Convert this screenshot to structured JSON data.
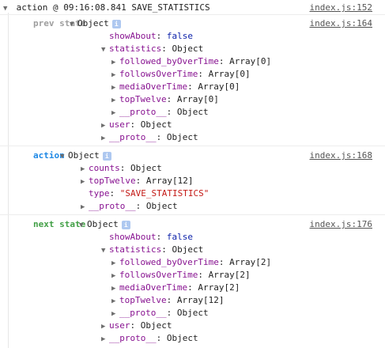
{
  "header": {
    "title": "action @ 09:16:08.841 SAVE_STATISTICS",
    "link": "index.js:152"
  },
  "groups": [
    {
      "label": "prev state",
      "label_color": "#9e9e9e",
      "link": "index.js:164",
      "lines": [
        {
          "indent": 0,
          "tri": "▼",
          "key": "",
          "val": "Object",
          "info": true
        },
        {
          "indent": 1,
          "key": "showAbout",
          "val": "false",
          "vclass": "kw"
        },
        {
          "indent": 1,
          "tri": "▼",
          "key": "statistics",
          "val": "Object"
        },
        {
          "indent": 2,
          "tri": "▶",
          "key": "followed_byOverTime",
          "val": "Array[0]"
        },
        {
          "indent": 2,
          "tri": "▶",
          "key": "followsOverTime",
          "val": "Array[0]"
        },
        {
          "indent": 2,
          "tri": "▶",
          "key": "mediaOverTime",
          "val": "Array[0]"
        },
        {
          "indent": 2,
          "tri": "▶",
          "key": "topTwelve",
          "val": "Array[0]"
        },
        {
          "indent": 2,
          "tri": "▶",
          "key": "__proto__",
          "val": "Object"
        },
        {
          "indent": 1,
          "tri": "▶",
          "key": "user",
          "val": "Object"
        },
        {
          "indent": 1,
          "tri": "▶",
          "key": "__proto__",
          "val": "Object"
        }
      ]
    },
    {
      "label": "action",
      "label_color": "#1e88e5",
      "link": "index.js:168",
      "lines": [
        {
          "indent": 0,
          "tri": "▼",
          "key": "",
          "val": "Object",
          "info": true
        },
        {
          "indent": 1,
          "tri": "▶",
          "key": "counts",
          "val": "Object"
        },
        {
          "indent": 1,
          "tri": "▶",
          "key": "topTwelve",
          "val": "Array[12]"
        },
        {
          "indent": 1,
          "key": "type",
          "val": "\"SAVE_STATISTICS\"",
          "vclass": "str"
        },
        {
          "indent": 1,
          "tri": "▶",
          "key": "__proto__",
          "val": "Object"
        }
      ]
    },
    {
      "label": "next state",
      "label_color": "#43a047",
      "link": "index.js:176",
      "lines": [
        {
          "indent": 0,
          "tri": "▼",
          "key": "",
          "val": "Object",
          "info": true
        },
        {
          "indent": 1,
          "key": "showAbout",
          "val": "false",
          "vclass": "kw"
        },
        {
          "indent": 1,
          "tri": "▼",
          "key": "statistics",
          "val": "Object"
        },
        {
          "indent": 2,
          "tri": "▶",
          "key": "followed_byOverTime",
          "val": "Array[2]"
        },
        {
          "indent": 2,
          "tri": "▶",
          "key": "followsOverTime",
          "val": "Array[2]"
        },
        {
          "indent": 2,
          "tri": "▶",
          "key": "mediaOverTime",
          "val": "Array[2]"
        },
        {
          "indent": 2,
          "tri": "▶",
          "key": "topTwelve",
          "val": "Array[12]"
        },
        {
          "indent": 2,
          "tri": "▶",
          "key": "__proto__",
          "val": "Object"
        },
        {
          "indent": 1,
          "tri": "▶",
          "key": "user",
          "val": "Object"
        },
        {
          "indent": 1,
          "tri": "▶",
          "key": "__proto__",
          "val": "Object"
        }
      ]
    }
  ]
}
